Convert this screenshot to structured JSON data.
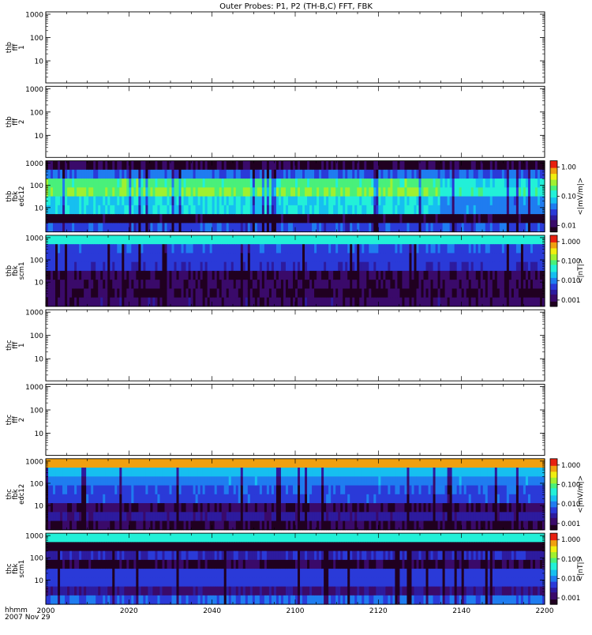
{
  "title": "Outer Probes: P1, P2 (TH-B,C) FFT, FBK",
  "time_axis": {
    "tick_labels": [
      "2000",
      "2020",
      "2040",
      "2100",
      "2120",
      "2140",
      "2200"
    ],
    "format_label": "hhmm",
    "date_label": "2007 Nov 29"
  },
  "colors": {
    "colormap": [
      "#200020",
      "#3a0a6a",
      "#2d1b9e",
      "#2a3ad8",
      "#1f7cf0",
      "#16bff0",
      "#22f0d8",
      "#49f07a",
      "#a0f030",
      "#f0ee10",
      "#f0a010",
      "#e82010"
    ]
  },
  "chart_data": [
    {
      "type": "heatmap",
      "panel_id": "thb-fff1",
      "ylabel_lines": [
        "thb",
        "fff",
        "1"
      ],
      "y_ticks": [
        "1000",
        "100",
        "10",
        "1"
      ],
      "has_data": false
    },
    {
      "type": "heatmap",
      "panel_id": "thb-fff2",
      "ylabel_lines": [
        "thb",
        "fff",
        "2"
      ],
      "y_ticks": [
        "1000",
        "100",
        "10",
        "1"
      ],
      "has_data": false
    },
    {
      "type": "heatmap",
      "panel_id": "thb-fbk-edc12",
      "ylabel_lines": [
        "thb",
        "fbk",
        "edc12"
      ],
      "y_ticks": [
        "1000",
        "100",
        "10"
      ],
      "colorbar": {
        "ticks": [
          "1.00",
          "0.10",
          "0.01"
        ],
        "unit": "<|mV/m|>",
        "range": [
          0.003,
          1.5
        ]
      },
      "has_data": true,
      "bands": [
        {
          "name": "band-1",
          "base": 0.08,
          "var": 0.04
        },
        {
          "name": "band-2",
          "base": 0.35,
          "var": 0.05
        },
        {
          "name": "band-3",
          "base": 0.62,
          "var": 0.05
        },
        {
          "name": "band-4",
          "base": 0.67,
          "var": 0.05
        },
        {
          "name": "band-5",
          "base": 0.5,
          "var": 0.05
        },
        {
          "name": "band-6",
          "base": 0.5,
          "var": 0.04
        },
        {
          "name": "band-7",
          "base": 0.05,
          "var": 0.04
        },
        {
          "name": "band-8",
          "base": 0.3,
          "var": 0.06
        }
      ]
    },
    {
      "type": "heatmap",
      "panel_id": "thb-fbk-scm1",
      "ylabel_lines": [
        "thb",
        "fbk",
        "scm1"
      ],
      "y_ticks": [
        "1000",
        "100",
        "10"
      ],
      "colorbar": {
        "ticks": [
          "1.000",
          "0.100",
          "0.010",
          "0.001"
        ],
        "unit": "<|nT|>",
        "range": [
          0.0006,
          1.5
        ]
      },
      "has_data": true,
      "bands": [
        {
          "name": "band-1",
          "base": 0.52,
          "var": 0.02
        },
        {
          "name": "band-2",
          "base": 0.32,
          "var": 0.03
        },
        {
          "name": "band-3",
          "base": 0.3,
          "var": 0.03
        },
        {
          "name": "band-4",
          "base": 0.26,
          "var": 0.03
        },
        {
          "name": "band-5",
          "base": 0.08,
          "var": 0.06
        },
        {
          "name": "band-6",
          "base": 0.1,
          "var": 0.05
        },
        {
          "name": "band-7",
          "base": 0.08,
          "var": 0.05
        },
        {
          "name": "band-8",
          "base": 0.12,
          "var": 0.05
        }
      ]
    },
    {
      "type": "heatmap",
      "panel_id": "thc-fff1",
      "ylabel_lines": [
        "thc",
        "fff",
        "1"
      ],
      "y_ticks": [
        "1000",
        "100",
        "10",
        "1"
      ],
      "has_data": false
    },
    {
      "type": "heatmap",
      "panel_id": "thc-fff2",
      "ylabel_lines": [
        "thc",
        "fff",
        "2"
      ],
      "y_ticks": [
        "1000",
        "100",
        "10",
        "1"
      ],
      "has_data": false
    },
    {
      "type": "heatmap",
      "panel_id": "thc-fbk-edc12",
      "ylabel_lines": [
        "thc",
        "fbk",
        "edc12"
      ],
      "y_ticks": [
        "1000",
        "100",
        "10"
      ],
      "colorbar": {
        "ticks": [
          "1.000",
          "0.100",
          "0.010",
          "0.001"
        ],
        "unit": "<|mV/m|>",
        "range": [
          0.0006,
          1.5
        ]
      },
      "has_data": true,
      "bands": [
        {
          "name": "band-1",
          "base": 0.88,
          "var": 0.02
        },
        {
          "name": "band-2",
          "base": 0.46,
          "var": 0.03
        },
        {
          "name": "band-3",
          "base": 0.38,
          "var": 0.04
        },
        {
          "name": "band-4",
          "base": 0.32,
          "var": 0.04
        },
        {
          "name": "band-5",
          "base": 0.3,
          "var": 0.04
        },
        {
          "name": "band-6",
          "base": 0.1,
          "var": 0.06
        },
        {
          "name": "band-7",
          "base": 0.2,
          "var": 0.05
        },
        {
          "name": "band-8",
          "base": 0.08,
          "var": 0.06
        }
      ]
    },
    {
      "type": "heatmap",
      "panel_id": "thc-fbk-scm1",
      "ylabel_lines": [
        "thc",
        "fbk",
        "scm1"
      ],
      "y_ticks": [
        "1000",
        "100",
        "10"
      ],
      "colorbar": {
        "ticks": [
          "1.000",
          "0.100",
          "0.010",
          "0.001"
        ],
        "unit": "<|nT|>",
        "range": [
          0.0006,
          1.5
        ]
      },
      "has_data": true,
      "bands": [
        {
          "name": "band-1",
          "base": 0.52,
          "var": 0.02
        },
        {
          "name": "band-2",
          "base": 0.0,
          "var": 0.02
        },
        {
          "name": "band-3",
          "base": 0.24,
          "var": 0.05
        },
        {
          "name": "band-4",
          "base": 0.08,
          "var": 0.06
        },
        {
          "name": "band-5",
          "base": 0.3,
          "var": 0.03
        },
        {
          "name": "band-6",
          "base": 0.28,
          "var": 0.03
        },
        {
          "name": "band-7",
          "base": 0.16,
          "var": 0.05
        },
        {
          "name": "band-8",
          "base": 0.34,
          "var": 0.04
        }
      ]
    }
  ]
}
